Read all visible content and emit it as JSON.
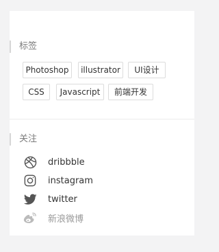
{
  "tags_section": {
    "title": "标签",
    "tags": [
      "Photoshop",
      "illustrator",
      "UI设计",
      "CSS",
      "Javascript",
      "前端开发"
    ]
  },
  "follow_section": {
    "title": "关注",
    "items": [
      {
        "label": "dribbble",
        "icon": "dribbble-icon"
      },
      {
        "label": "instagram",
        "icon": "instagram-icon"
      },
      {
        "label": "twitter",
        "icon": "twitter-icon"
      },
      {
        "label": "新浪微博",
        "icon": "weibo-icon"
      }
    ]
  },
  "colors": {
    "icon": "#555555",
    "muted_icon": "#bbbbbb",
    "accent_bar": "#d6d6d6"
  }
}
